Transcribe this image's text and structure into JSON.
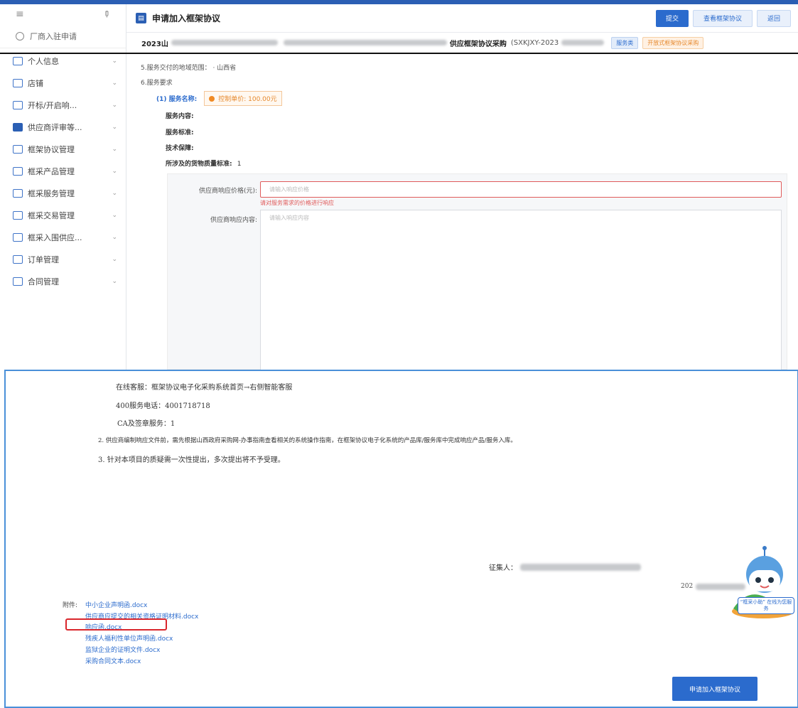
{
  "sidebar": {
    "sub_item": "厂商入驻申请",
    "items": [
      {
        "label": "个人信息",
        "icon": "user-icon"
      },
      {
        "label": "店铺",
        "icon": "store-icon"
      },
      {
        "label": "开标/开启响...",
        "icon": "bid-icon"
      },
      {
        "label": "供应商评审等...",
        "icon": "grid-icon"
      },
      {
        "label": "框架协议管理",
        "icon": "agreement-icon"
      },
      {
        "label": "框采产品管理",
        "icon": "product-icon"
      },
      {
        "label": "框采服务管理",
        "icon": "service-icon"
      },
      {
        "label": "框采交易管理",
        "icon": "trade-icon"
      },
      {
        "label": "框采入围供应...",
        "icon": "shortlist-icon"
      },
      {
        "label": "订单管理",
        "icon": "order-icon"
      },
      {
        "label": "合同管理",
        "icon": "contract-icon"
      }
    ]
  },
  "header": {
    "title": "申请加入框架协议",
    "buttons": {
      "submit": "提交",
      "view_agreement": "查看框架协议",
      "back": "返回"
    }
  },
  "project": {
    "prefix": "2023山",
    "suffix": "供应框架协议采购",
    "code": "(SXKJXY-2023",
    "tag_service": "服务类",
    "tag_open": "开放式框架协议采购"
  },
  "requirements": {
    "region": "5.服务交付的地域范围：  · 山西省",
    "service_req": "6.服务要求",
    "service_name_label": "(1) 服务名称:",
    "control_price": "控制单价: 100.00元",
    "content": "服务内容:",
    "standard": "服务标准:",
    "guarantee": "技术保障:",
    "quality": "所涉及的货物质量标准:",
    "quality_value": "1"
  },
  "response_form": {
    "price_label": "供应商响应价格(元):",
    "price_placeholder": "请输入响应价格",
    "price_error": "请对服务需求的价格进行响应",
    "content_label": "供应商响应内容:",
    "content_placeholder": "请输入响应内容"
  },
  "document": {
    "lines": [
      "在线客服：框架协议电子化采购系统首页→右侧智能客服",
      "400服务电话：4001718718",
      "CA及签章服务：1",
      "2. 供应商编制响应文件前，需先根据山西政府采购网-办事指南查看相关的系统操作指南，在框架协议电子化系统的产品库/服务库中完成响应产品/服务入库。",
      "3. 针对本项目的质疑需一次性提出，多次提出将不予受理。"
    ],
    "collector_label": "征集人：",
    "date_prefix": "202"
  },
  "attachments": {
    "label": "附件:",
    "files": [
      "中小企业声明函.docx",
      "供应商应提交的相关资格证明材料.docx",
      "响应函.docx",
      "残疾人福利性单位声明函.docx",
      "监狱企业的证明文件.docx",
      "采购合同文本.docx"
    ]
  },
  "apply_button": "申请加入框架协议",
  "assistant": {
    "caption": "“框采小助” 在线为您服务"
  },
  "colors": {
    "primary": "#2b6bcd",
    "error": "#e05b5b",
    "warning": "#e6892e",
    "highlight": "#d9262c"
  }
}
